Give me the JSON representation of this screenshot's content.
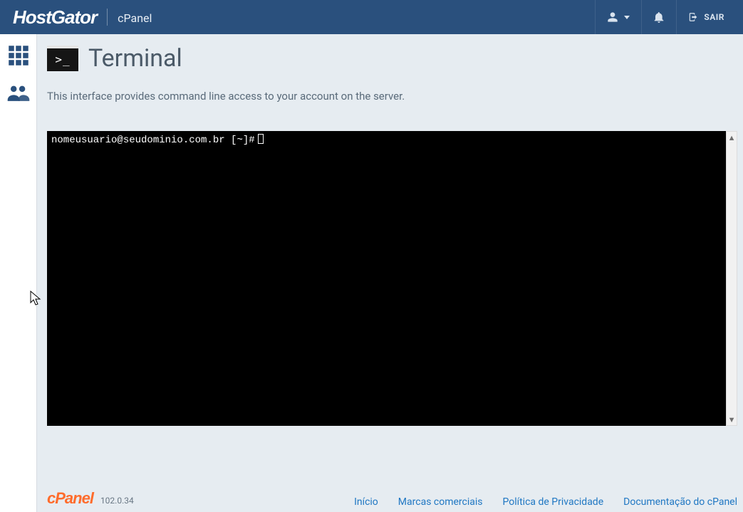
{
  "header": {
    "brand_primary": "HostGator",
    "brand_secondary": "cPanel",
    "logout_label": "SAIR"
  },
  "page": {
    "title": "Terminal",
    "description": "This interface provides command line access to your account on the server."
  },
  "terminal": {
    "prompt": "nomeusuario@seudominio.com.br [~]#"
  },
  "footer": {
    "logo_text": "cPanel",
    "version": "102.0.34",
    "links": [
      {
        "label": "Início"
      },
      {
        "label": "Marcas comerciais"
      },
      {
        "label": "Política de Privacidade"
      },
      {
        "label": "Documentação do cPanel"
      }
    ]
  }
}
